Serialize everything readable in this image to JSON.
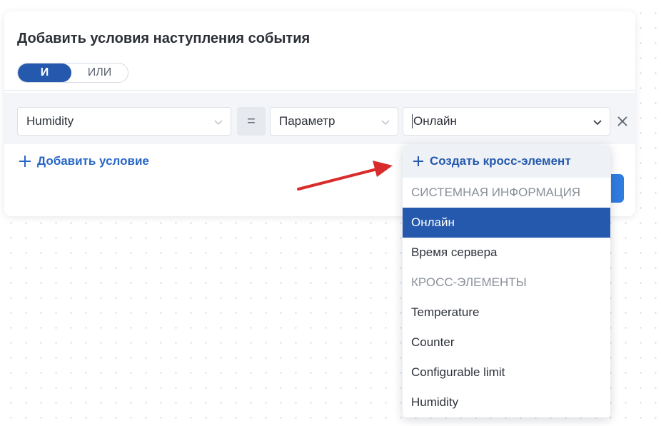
{
  "dialog": {
    "title": "Добавить условия наступления события",
    "logic_toggle": {
      "and_label": "И",
      "or_label": "ИЛИ",
      "selected": "И"
    }
  },
  "condition": {
    "left_value": "Humidity",
    "operator": "=",
    "type_value": "Параметр",
    "right_value": "Онлайн"
  },
  "add_condition_label": "Добавить условие",
  "dropdown": {
    "create_label": "Создать кросс-элемент",
    "groups": [
      {
        "title": "СИСТЕМНАЯ ИНФОРМАЦИЯ",
        "items": [
          "Онлайн",
          "Время сервера"
        ]
      },
      {
        "title": "КРОСС-ЭЛЕМЕНТЫ",
        "items": [
          "Temperature",
          "Counter",
          "Configurable limit",
          "Humidity"
        ]
      }
    ],
    "selected_item": "Онлайн"
  },
  "colors": {
    "accent": "#2459ad",
    "link": "#2867c5",
    "annotation_arrow": "#d92b2b"
  }
}
